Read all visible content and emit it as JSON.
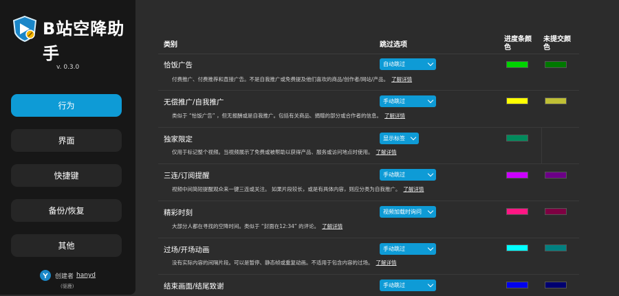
{
  "app": {
    "title": "B站空降助手",
    "version": "v. 0.3.0"
  },
  "nav": [
    {
      "label": "行为",
      "active": true
    },
    {
      "label": "界面",
      "active": false
    },
    {
      "label": "快捷键",
      "active": false
    },
    {
      "label": "备份/恢复",
      "active": false
    },
    {
      "label": "其他",
      "active": false
    }
  ],
  "footer": {
    "creator_label": "创建者",
    "creator_name": "hanyd",
    "note": "(驱鹿)"
  },
  "table": {
    "headers": {
      "category": "类别",
      "skip_option": "跳过选项",
      "progress_color": "进度条颜色",
      "unsubmitted_color": "未提交颜色"
    },
    "more_label": "了解详情",
    "rows": [
      {
        "title": "恰饭广告",
        "desc": "付费推广、付费推荐和直接广告。不是自我推广或免费提及他们喜欢的商品/创作者/网站/产品。",
        "option": "自动跳过",
        "bar": "#00d400",
        "unsub": "#007800"
      },
      {
        "title": "无偿推广/自我推广",
        "desc": "类似于 “恰饭广告” ，但无报酬或是自我推广。包括有关商品、捐赠的部分或合作者的信息。",
        "option": "手动跳过",
        "bar": "#ffff00",
        "unsub": "#bfbf35"
      },
      {
        "title": "独家限定",
        "desc": "仅用于标记整个视频。当视频展示了免费或被帮助以获得产品、服务或访问地点时使用。",
        "option": "显示标签",
        "bar": "#008a5c",
        "unsub": ""
      },
      {
        "title": "三连/订阅提醒",
        "desc": "视频中间简短提醒观众来一键三连或关注。 如果片段较长，或是有具体内容，则应分类为自我推广。",
        "option": "手动跳过",
        "bar": "#cc00ff",
        "unsub": "#6c0087"
      },
      {
        "title": "精彩时刻",
        "desc": "大部分人都在寻找的空降时间。类似于 “封面在12:34” 的评论。",
        "option": "视频加载时询问",
        "bar": "#ff1684",
        "unsub": "#7e0042"
      },
      {
        "title": "过场/开场动画",
        "desc": "没有实际内容的间隔片段。可以是暂停、静态帧或重复动画。不适用于包含内容的过场。",
        "option": "手动跳过",
        "bar": "#00ffff",
        "unsub": "#008080"
      },
      {
        "title": "结束画面/结尾致谢",
        "desc": "",
        "option": "手动跳过",
        "bar": "#0202ed",
        "unsub": "#000070"
      }
    ]
  }
}
